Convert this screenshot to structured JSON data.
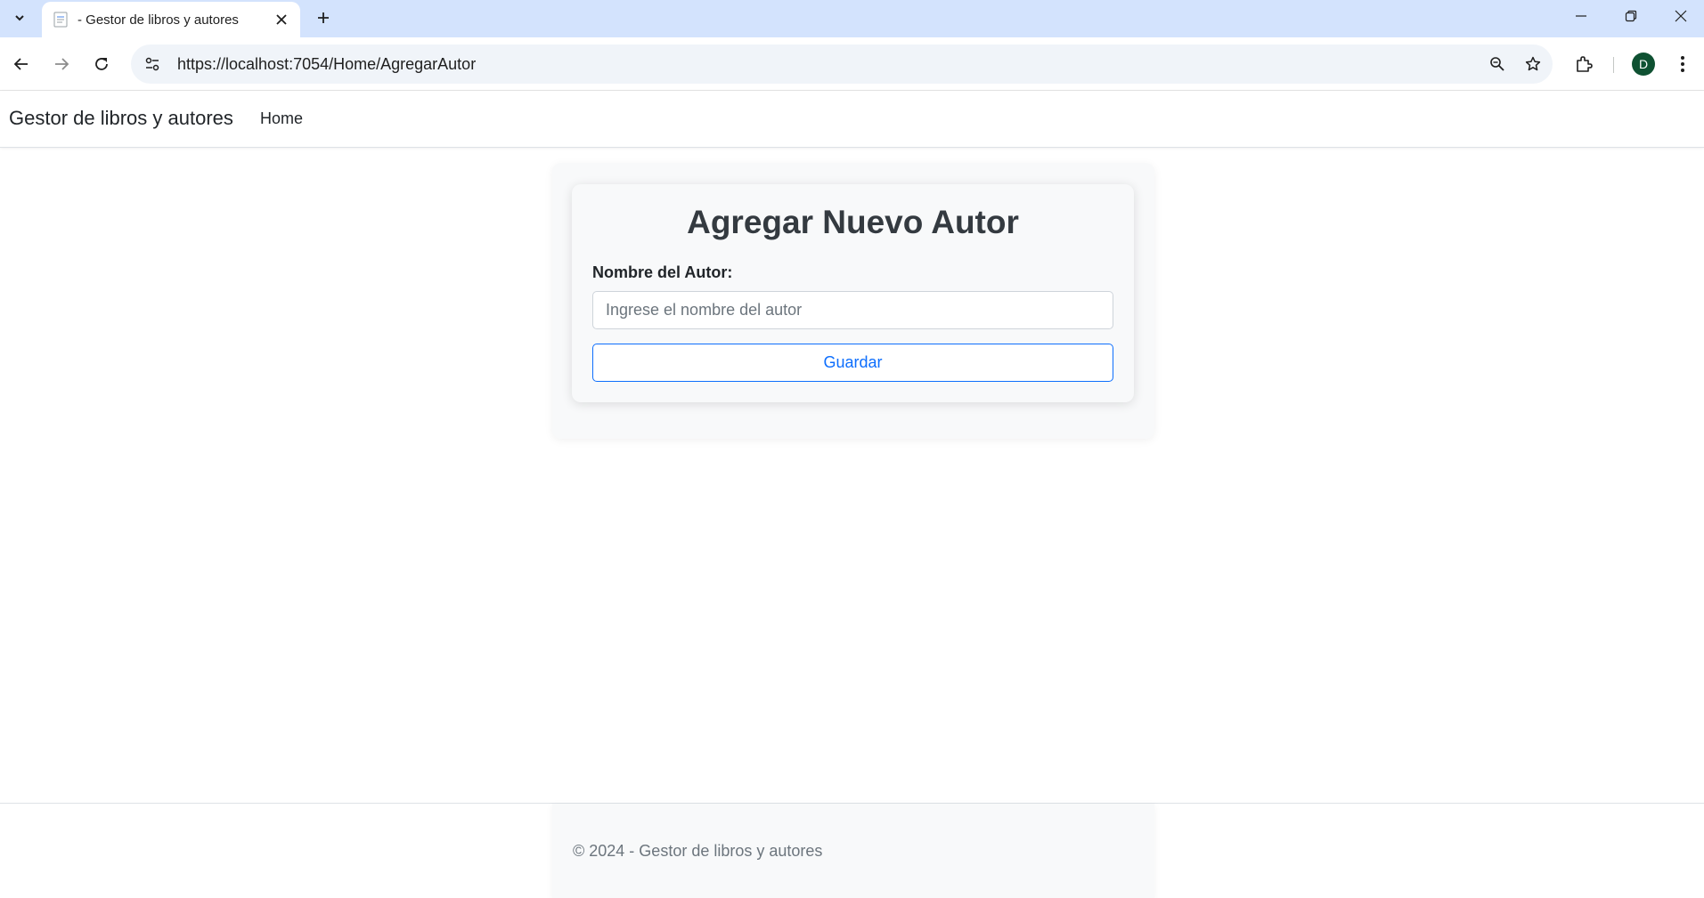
{
  "browser": {
    "tab_title": "- Gestor de libros y autores",
    "url": "https://localhost:7054/Home/AgregarAutor",
    "profile_initial": "D"
  },
  "navbar": {
    "brand": "Gestor de libros y autores",
    "links": [
      {
        "label": "Home"
      }
    ]
  },
  "form": {
    "title": "Agregar Nuevo Autor",
    "author_label": "Nombre del Autor:",
    "author_value": "",
    "author_placeholder": "Ingrese el nombre del autor",
    "submit_label": "Guardar"
  },
  "footer": {
    "text": "© 2024 - Gestor de libros y autores"
  },
  "colors": {
    "primary": "#0d6efd",
    "tabstrip": "#d3e3fd",
    "avatar": "#0f5132"
  }
}
